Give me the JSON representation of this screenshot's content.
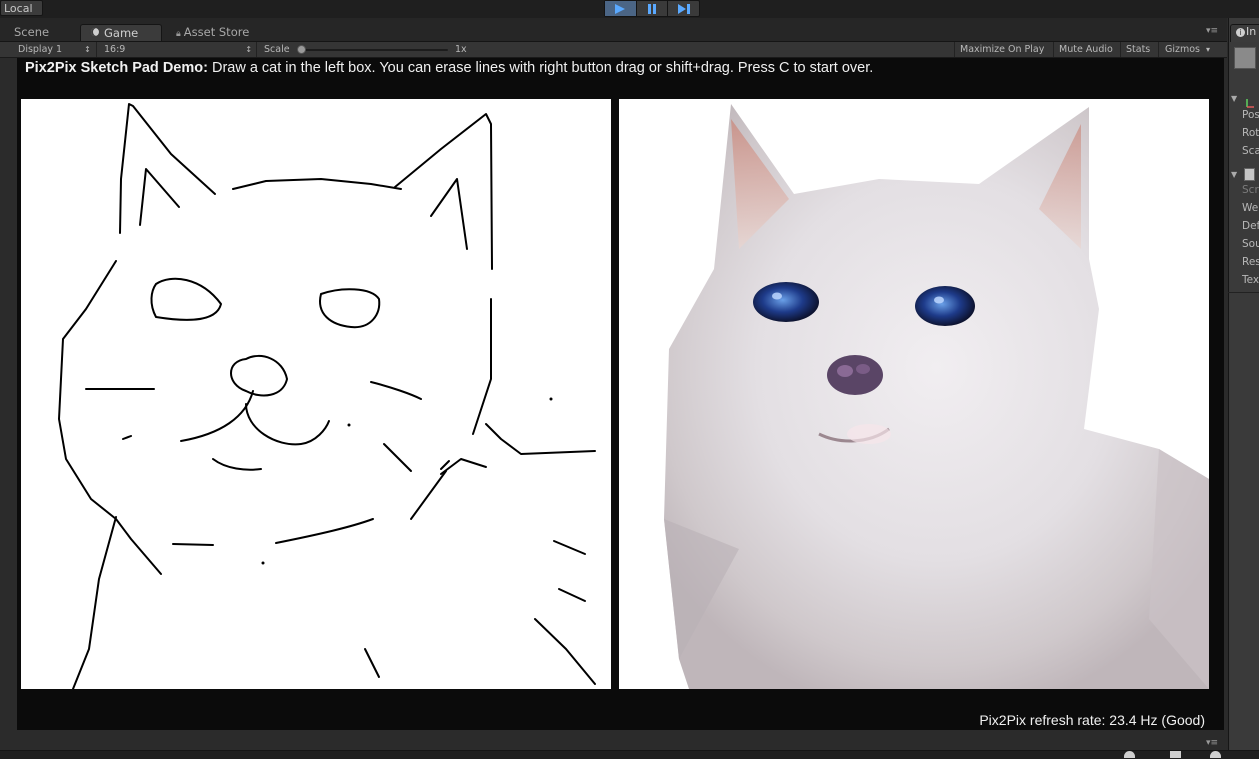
{
  "top_bar": {
    "local_label": "Local",
    "play_controls": [
      "play",
      "pause",
      "step"
    ]
  },
  "tabs": [
    {
      "label": "Scene",
      "active": false
    },
    {
      "label": "Game",
      "active": true
    },
    {
      "label": "Asset Store",
      "active": false
    }
  ],
  "game_toolbar": {
    "display": "Display 1",
    "aspect": "16:9",
    "scale_label": "Scale",
    "scale_value": "1x",
    "scale_fraction": 0.0,
    "maximize_on_play": "Maximize On Play",
    "mute_audio": "Mute Audio",
    "stats": "Stats",
    "gizmos": "Gizmos"
  },
  "game_view": {
    "instruction_bold": "Pix2Pix Sketch Pad Demo:",
    "instruction_rest": " Draw a cat in the left box. You can erase lines with right button drag or shift+drag. Press C to start over.",
    "refresh_rate": "Pix2Pix refresh rate: 23.4 Hz (Good)"
  },
  "inspector": {
    "tab_label": "In",
    "rows": [
      "Pos",
      "Rot",
      "Sca",
      "Scr",
      "We",
      "Def",
      "Sou",
      "Res",
      "Tex"
    ]
  },
  "colors": {
    "accent_play": "#4b6585",
    "play_icon": "#5aa9ff",
    "game_background": "#0b0b0b"
  }
}
